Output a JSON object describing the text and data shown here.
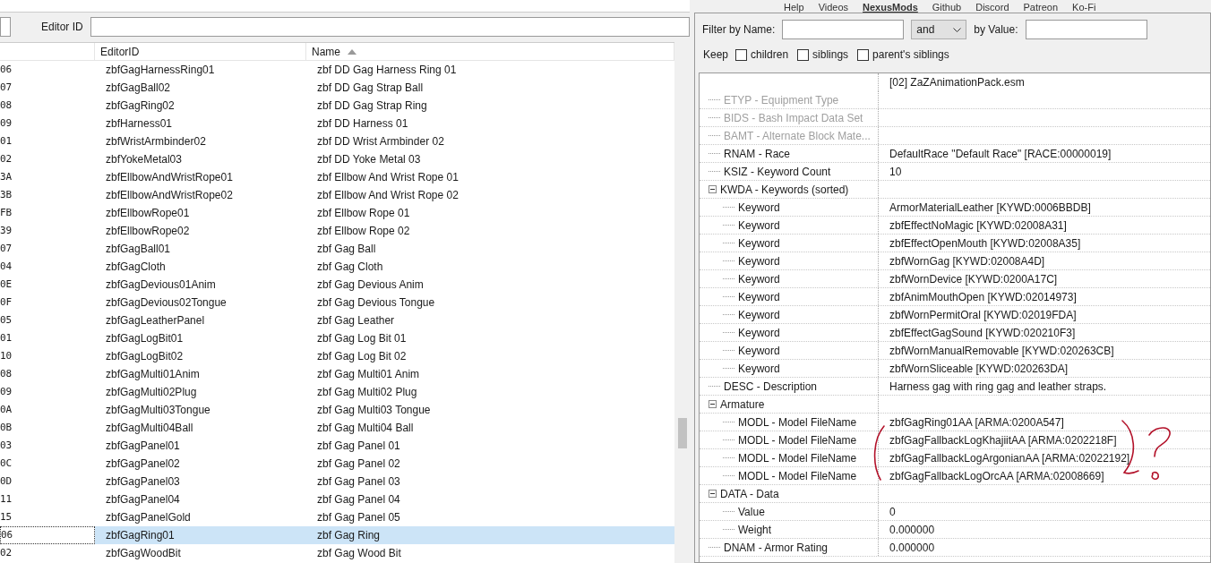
{
  "toolbar": {
    "links": [
      {
        "label": "Help"
      },
      {
        "label": "Videos"
      },
      {
        "label": "NexusMods"
      },
      {
        "label": "Github"
      },
      {
        "label": "Discord"
      },
      {
        "label": "Patreon"
      },
      {
        "label": "Ko-Fi"
      }
    ]
  },
  "editor_id_filter": {
    "label": "Editor ID"
  },
  "records": {
    "columns": [
      {
        "label": "EditorID"
      },
      {
        "label": "Name",
        "sorted": true
      }
    ],
    "rows": [
      {
        "column_1": "06",
        "editor_id": "zbfGagHarnessRing01",
        "name": "zbf DD Gag Harness Ring 01",
        "selected": false
      },
      {
        "column_1": "07",
        "editor_id": "zbfGagBall02",
        "name": "zbf DD Gag Strap Ball",
        "selected": false
      },
      {
        "column_1": "08",
        "editor_id": "zbfGagRing02",
        "name": "zbf DD Gag Strap Ring",
        "selected": false
      },
      {
        "column_1": "09",
        "editor_id": "zbfHarness01",
        "name": "zbf DD Harness 01",
        "selected": false
      },
      {
        "column_1": "01",
        "editor_id": "zbfWristArmbinder02",
        "name": "zbf DD Wrist Armbinder 02",
        "selected": false
      },
      {
        "column_1": "02",
        "editor_id": "zbfYokeMetal03",
        "name": "zbf DD Yoke Metal 03",
        "selected": false
      },
      {
        "column_1": "3A",
        "editor_id": "zbfEllbowAndWristRope01",
        "name": "zbf Ellbow And Wrist Rope 01",
        "selected": false
      },
      {
        "column_1": "3B",
        "editor_id": "zbfEllbowAndWristRope02",
        "name": "zbf Ellbow And Wrist Rope 02",
        "selected": false
      },
      {
        "column_1": "FB",
        "editor_id": "zbfEllbowRope01",
        "name": "zbf Ellbow Rope 01",
        "selected": false
      },
      {
        "column_1": "39",
        "editor_id": "zbfEllbowRope02",
        "name": "zbf Ellbow Rope 02",
        "selected": false
      },
      {
        "column_1": "07",
        "editor_id": "zbfGagBall01",
        "name": "zbf Gag Ball",
        "selected": false
      },
      {
        "column_1": "04",
        "editor_id": "zbfGagCloth",
        "name": "zbf Gag Cloth",
        "selected": false
      },
      {
        "column_1": "0E",
        "editor_id": "zbfGagDevious01Anim",
        "name": "zbf Gag Devious Anim",
        "selected": false
      },
      {
        "column_1": "0F",
        "editor_id": "zbfGagDevious02Tongue",
        "name": "zbf Gag Devious Tongue",
        "selected": false
      },
      {
        "column_1": "05",
        "editor_id": "zbfGagLeatherPanel",
        "name": "zbf Gag Leather",
        "selected": false
      },
      {
        "column_1": "01",
        "editor_id": "zbfGagLogBit01",
        "name": "zbf Gag Log Bit 01",
        "selected": false
      },
      {
        "column_1": "10",
        "editor_id": "zbfGagLogBit02",
        "name": "zbf Gag Log Bit 02",
        "selected": false
      },
      {
        "column_1": "08",
        "editor_id": "zbfGagMulti01Anim",
        "name": "zbf Gag Multi01 Anim",
        "selected": false
      },
      {
        "column_1": "09",
        "editor_id": "zbfGagMulti02Plug",
        "name": "zbf Gag Multi02 Plug",
        "selected": false
      },
      {
        "column_1": "0A",
        "editor_id": "zbfGagMulti03Tongue",
        "name": "zbf Gag Multi03 Tongue",
        "selected": false
      },
      {
        "column_1": "0B",
        "editor_id": "zbfGagMulti04Ball",
        "name": "zbf Gag Multi04 Ball",
        "selected": false
      },
      {
        "column_1": "03",
        "editor_id": "zbfGagPanel01",
        "name": "zbf Gag Panel 01",
        "selected": false
      },
      {
        "column_1": "0C",
        "editor_id": "zbfGagPanel02",
        "name": "zbf Gag Panel 02",
        "selected": false
      },
      {
        "column_1": "0D",
        "editor_id": "zbfGagPanel03",
        "name": "zbf Gag Panel 03",
        "selected": false
      },
      {
        "column_1": "11",
        "editor_id": "zbfGagPanel04",
        "name": "zbf Gag Panel 04",
        "selected": false
      },
      {
        "column_1": "15",
        "editor_id": "zbfGagPanelGold",
        "name": "zbf Gag Panel 05",
        "selected": false
      },
      {
        "column_1": "06",
        "editor_id": "zbfGagRing01",
        "name": "zbf Gag Ring",
        "selected": true
      },
      {
        "column_1": "02",
        "editor_id": "zbfGagWoodBit",
        "name": "zbf Gag Wood Bit",
        "selected": false
      }
    ]
  },
  "filter": {
    "name_label": "Filter by Name:",
    "operator": "and",
    "value_label": "by Value:",
    "keep_label": "Keep",
    "keep_options": [
      {
        "label": "children",
        "checked": false
      },
      {
        "label": "siblings",
        "checked": false
      },
      {
        "label": "parent's siblings",
        "checked": false
      }
    ]
  },
  "record_view": {
    "file": "[02] ZaZAnimationPack.esm",
    "fields": [
      {
        "label": "ETYP - Equipment Type",
        "disabled": true
      },
      {
        "label": "BIDS - Bash Impact Data Set",
        "disabled": true
      },
      {
        "label": "BAMT - Alternate Block Mate...",
        "disabled": true
      },
      {
        "label": "RNAM - Race",
        "value": "DefaultRace \"Default Race\" [RACE:00000019]",
        "disabled": false
      },
      {
        "label": "KSIZ - Keyword Count",
        "value": "10",
        "disabled": false
      },
      {
        "label": "KWDA - Keywords (sorted)",
        "disabled": false,
        "expanded": true,
        "children": [
          {
            "label": "Keyword",
            "value": "ArmorMaterialLeather [KYWD:0006BBDB]"
          },
          {
            "label": "Keyword",
            "value": "zbfEffectNoMagic [KYWD:02008A31]"
          },
          {
            "label": "Keyword",
            "value": "zbfEffectOpenMouth [KYWD:02008A35]"
          },
          {
            "label": "Keyword",
            "value": "zbfWornGag [KYWD:02008A4D]"
          },
          {
            "label": "Keyword",
            "value": "zbfWornDevice [KYWD:0200A17C]"
          },
          {
            "label": "Keyword",
            "value": "zbfAnimMouthOpen [KYWD:02014973]"
          },
          {
            "label": "Keyword",
            "value": "zbfWornPermitOral [KYWD:02019FDA]"
          },
          {
            "label": "Keyword",
            "value": "zbfEffectGagSound [KYWD:020210F3]"
          },
          {
            "label": "Keyword",
            "value": "zbfWornManualRemovable [KYWD:020263CB]"
          },
          {
            "label": "Keyword",
            "value": "zbfWornSliceable [KYWD:020263DA]"
          }
        ]
      },
      {
        "label": "DESC - Description",
        "value": "Harness gag with ring gag and leather straps.",
        "disabled": false
      },
      {
        "label": "Armature",
        "disabled": false,
        "expanded": true,
        "children": [
          {
            "label": "MODL - Model FileName",
            "value": "zbfGagRing01AA [ARMA:0200A547]"
          },
          {
            "label": "MODL - Model FileName",
            "value": "zbfGagFallbackLogKhajiitAA [ARMA:0202218F]"
          },
          {
            "label": "MODL - Model FileName",
            "value": "zbfGagFallbackLogArgonianAA [ARMA:02022192]"
          },
          {
            "label": "MODL - Model FileName",
            "value": "zbfGagFallbackLogOrcAA [ARMA:02008669]"
          }
        ]
      },
      {
        "label": "DATA - Data",
        "disabled": false,
        "expanded": true,
        "children": [
          {
            "label": "Value",
            "value": "0"
          },
          {
            "label": "Weight",
            "value": "0.000000"
          }
        ]
      },
      {
        "label": "DNAM - Armor Rating",
        "value": "0.000000",
        "disabled": false
      }
    ]
  }
}
